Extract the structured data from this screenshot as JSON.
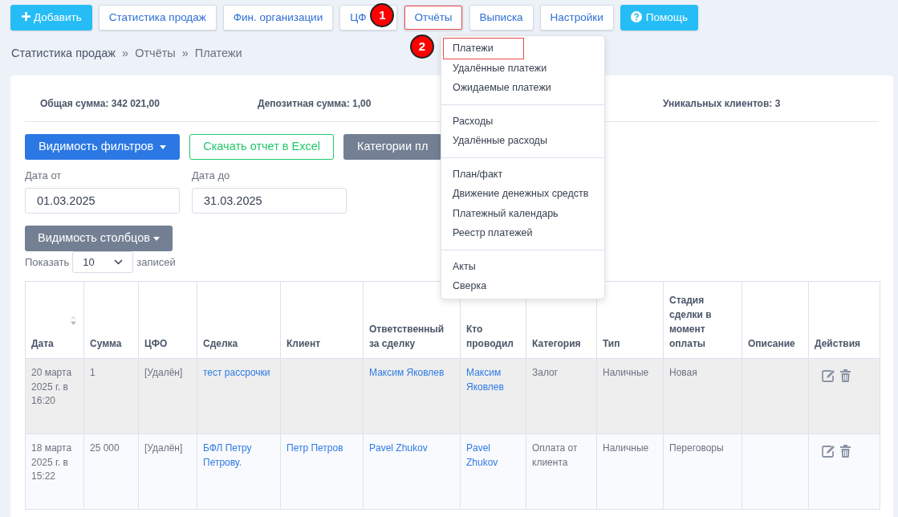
{
  "toolbar": [
    {
      "label": "Добавить",
      "kind": "add"
    },
    {
      "label": "Статистика продаж",
      "kind": "plain",
      "highlighted": false
    },
    {
      "label": "Фин. организации",
      "kind": "plain",
      "highlighted": false
    },
    {
      "label": "ЦФ",
      "kind": "plain",
      "highlighted": false
    },
    {
      "label": "Отчёты",
      "kind": "plain",
      "highlighted": true
    },
    {
      "label": "Выписка",
      "kind": "plain",
      "highlighted": false
    },
    {
      "label": "Настройки",
      "kind": "plain",
      "highlighted": false
    },
    {
      "label": "Помощь",
      "kind": "help"
    }
  ],
  "markers": [
    "1",
    "2"
  ],
  "breadcrumb": [
    {
      "label": "Статистика продаж",
      "link": true
    },
    {
      "label": "Отчёты",
      "link": false
    },
    {
      "label": "Платежи",
      "link": false
    }
  ],
  "breadcrumb_separator": "»",
  "summary": [
    "Общая сумма: 342 021,00",
    "Депозитная сумма: 1,00",
    "Уникальных клиентов: 3"
  ],
  "filter_buttons": [
    {
      "label": "Видимость фильтров",
      "kind": "primary"
    },
    {
      "label": "Скачать отчет в Excel",
      "kind": "excel"
    },
    {
      "label": "Категории пл",
      "kind": "secondary"
    }
  ],
  "date_from": {
    "label": "Дата от",
    "value": "01.03.2025"
  },
  "date_to": {
    "label": "Дата до",
    "value": "31.03.2025"
  },
  "columns_button": "Видимость столбцов",
  "page_length": {
    "prefix": "Показать",
    "value": "10",
    "suffix": "записей"
  },
  "table": {
    "columns": [
      "Дата",
      "Сумма",
      "ЦФО",
      "Сделка",
      "Клиент",
      "Ответственный за сделку",
      "Кто проводил",
      "Категория",
      "Тип",
      "Стадия сделки в момент оплаты",
      "Описание",
      "Действия"
    ],
    "rows": [
      {
        "cells": [
          {
            "text": "20 марта 2025 г. в 16:20",
            "link": false
          },
          {
            "text": "1",
            "link": false
          },
          {
            "text": "[Удалён]",
            "link": false
          },
          {
            "text": "тест рассрочки",
            "link": true
          },
          null,
          {
            "text": "Максим Яковлев",
            "link": true
          },
          {
            "text": "Максим Яковлев",
            "link": true
          },
          {
            "text": "Залог",
            "link": false
          },
          {
            "text": "Наличные",
            "link": false
          },
          {
            "text": "Новая",
            "link": false
          },
          null
        ],
        "shaded": true
      },
      {
        "cells": [
          {
            "text": "18 марта 2025 г. в 15:22",
            "link": false
          },
          {
            "text": "25 000",
            "link": false
          },
          {
            "text": "[Удалён]",
            "link": false
          },
          {
            "text": "БФЛ Петру Петрову.",
            "link": true
          },
          {
            "text": "Петр Петров",
            "link": true
          },
          {
            "text": "Pavel Zhukov",
            "link": true
          },
          {
            "text": "Pavel Zhukov",
            "link": true
          },
          {
            "text": "Оплата от клиента",
            "link": false
          },
          {
            "text": "Наличные",
            "link": false
          },
          {
            "text": "Переговоры",
            "link": false
          },
          null
        ],
        "shaded": false
      }
    ]
  },
  "reports_menu": {
    "groups": [
      [
        {
          "label": "Платежи",
          "highlighted": true
        },
        {
          "label": "Удалённые платежи",
          "highlighted": false
        },
        {
          "label": "Ожидаемые платежи",
          "highlighted": false
        }
      ],
      [
        {
          "label": "Расходы",
          "highlighted": false
        },
        {
          "label": "Удалённые расходы",
          "highlighted": false
        }
      ],
      [
        {
          "label": "План/факт",
          "highlighted": false
        },
        {
          "label": "Движение денежных средств",
          "highlighted": false
        },
        {
          "label": "Платежный календарь",
          "highlighted": false
        },
        {
          "label": "Реестр платежей",
          "highlighted": false
        }
      ],
      [
        {
          "label": "Акты",
          "highlighted": false
        },
        {
          "label": "Сверка",
          "highlighted": false
        }
      ]
    ]
  }
}
